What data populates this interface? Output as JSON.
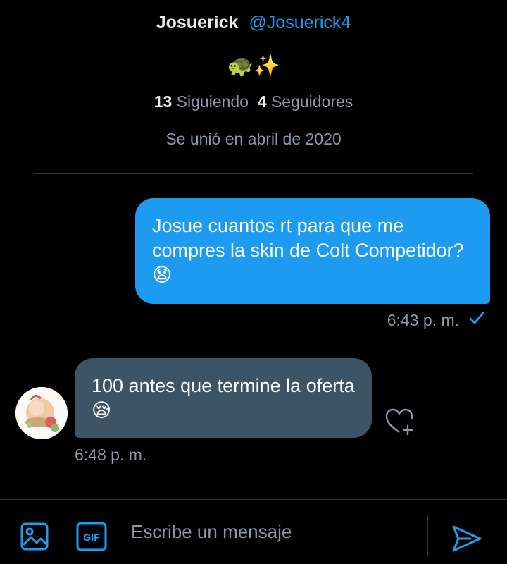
{
  "profile": {
    "display_name": "Josuerick",
    "handle": "@Josuerick4",
    "bio": "🐢✨",
    "following_count": "13",
    "following_label": "Siguiendo",
    "followers_count": "4",
    "followers_label": "Seguidores",
    "joined": "Se unió en abril de 2020"
  },
  "messages": [
    {
      "direction": "outgoing",
      "text": "Josue cuantos rt para que me compres la skin de Colt Competidor? 😧",
      "time": "6:43 p. m.",
      "status_icon": "checkmark-icon"
    },
    {
      "direction": "incoming",
      "text": "100 antes que termine la oferta 😪",
      "time": "6:48 p. m.",
      "reaction_icon": "heart-plus-icon"
    }
  ],
  "composer": {
    "placeholder": "Escribe un mensaje",
    "value": "",
    "gif_label": "GIF"
  },
  "colors": {
    "accent": "#1d9bf0",
    "incoming_bubble": "#3d5466",
    "muted_text": "#8b98a5",
    "background": "#000000"
  }
}
